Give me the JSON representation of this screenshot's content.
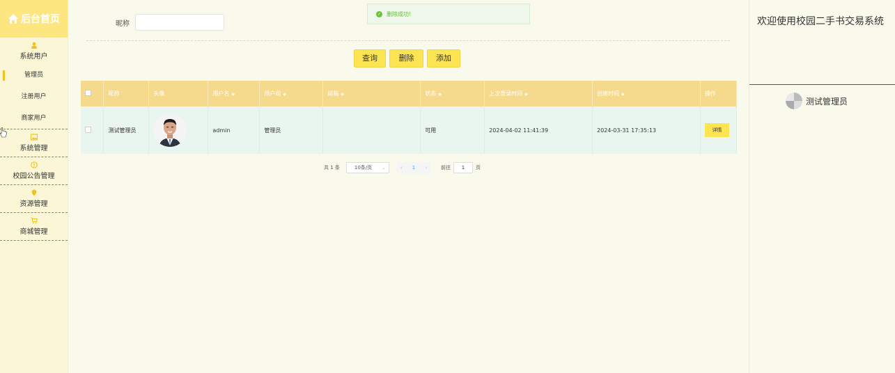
{
  "sidebar": {
    "brand": "后台首页",
    "groups": [
      {
        "label": "系统用户",
        "icon": "user-icon"
      },
      {
        "label": "系统管理",
        "icon": "picture-icon"
      },
      {
        "label": "校园公告管理",
        "icon": "info-circle-icon"
      },
      {
        "label": "资源管理",
        "icon": "location-pin-icon"
      },
      {
        "label": "商城管理",
        "icon": "cart-icon"
      }
    ],
    "sub_items": [
      "管理员",
      "注册用户",
      "商家用户"
    ]
  },
  "search": {
    "label": "昵称",
    "value": ""
  },
  "toast": {
    "message": "删除成功!"
  },
  "buttons": {
    "query": "查询",
    "delete": "删除",
    "add": "添加"
  },
  "table": {
    "headers": [
      "昵称",
      "头像",
      "用户名",
      "用户组",
      "邮箱",
      "状态",
      "上次登录时间",
      "创建时间",
      "操作"
    ],
    "rows": [
      {
        "nickname": "测试管理员",
        "username": "admin",
        "group": "管理员",
        "email": "",
        "status": "可用",
        "last_login": "2024-04-02 11:41:39",
        "created": "2024-03-31 17:35:13",
        "action": "详情"
      }
    ]
  },
  "pagination": {
    "total_text": "共 1 条",
    "page_size": "10条/页",
    "current_page": "1",
    "goto_label": "前往",
    "goto_value": "1",
    "page_suffix": "页"
  },
  "right": {
    "welcome": "欢迎使用校园二手书交易系统",
    "user_name": "测试管理员"
  }
}
